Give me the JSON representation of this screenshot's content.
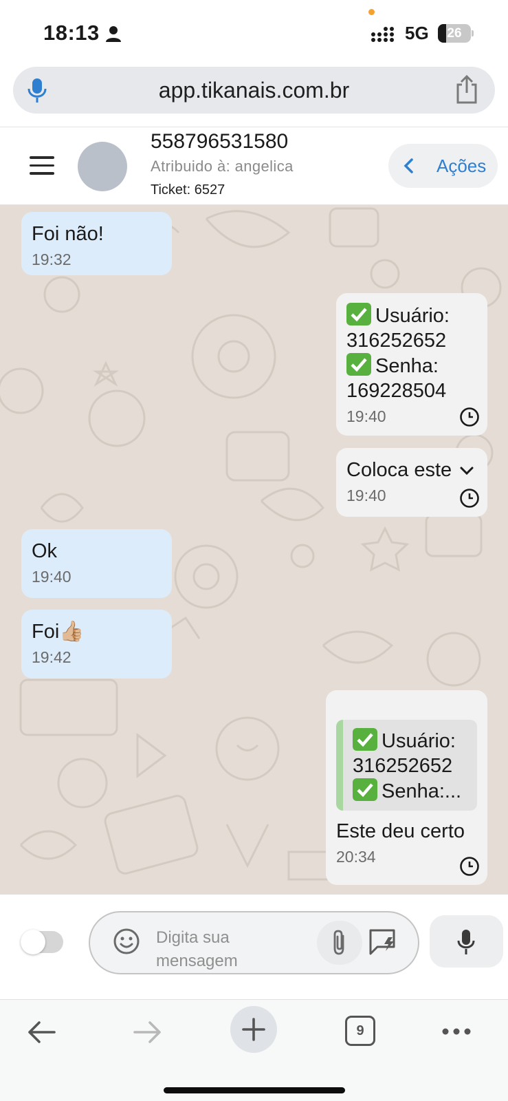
{
  "status_bar": {
    "time": "18:13",
    "network": "5G",
    "battery_level": "26",
    "icons": [
      "person-icon",
      "signal-bars-icon",
      "battery-icon"
    ]
  },
  "browser": {
    "url": "app.tikanais.com.br",
    "tab_count": "9",
    "icons": [
      "mic-icon",
      "share-icon",
      "back-arrow-icon",
      "forward-arrow-icon",
      "plus-icon",
      "tabs-icon",
      "more-dots-icon"
    ]
  },
  "header": {
    "contact_name": "558796531580",
    "assigned": "Atribuido à: angelica",
    "ticket": "Ticket: 6527",
    "actions_label": "Ações"
  },
  "messages": [
    {
      "direction": "incoming",
      "text": "Foi não!",
      "time": "19:32"
    },
    {
      "direction": "outgoing",
      "user_label": "Usuário:",
      "user_value": "316252652",
      "pass_label": "Senha:",
      "pass_value": "169228504",
      "time": "19:40",
      "status_icon": "clock-icon"
    },
    {
      "direction": "outgoing",
      "text": "Coloca este",
      "time": "19:40",
      "status_icon": "clock-icon"
    },
    {
      "direction": "incoming",
      "text": "Ok",
      "time": "19:40"
    },
    {
      "direction": "incoming",
      "text": "Foi👍🏼",
      "time": "19:42"
    },
    {
      "direction": "outgoing",
      "quote_user_label": "Usuário:",
      "quote_user_value": "316252652",
      "quote_pass_label": "Senha:...",
      "text": "Este deu certo",
      "time": "20:34",
      "status_icon": "clock-icon"
    }
  ],
  "composer": {
    "placeholder_line1": "Digita sua",
    "placeholder_line2": "mensagem",
    "icons": [
      "emoji-icon",
      "paperclip-icon",
      "quick-reply-icon",
      "mic-icon"
    ]
  },
  "colors": {
    "incoming_bubble": "#dcecfb",
    "outgoing_bubble": "#f2f2f2",
    "chat_background": "#e5ddd5",
    "accent": "#2f7fd0",
    "check_green": "#58b03e"
  }
}
